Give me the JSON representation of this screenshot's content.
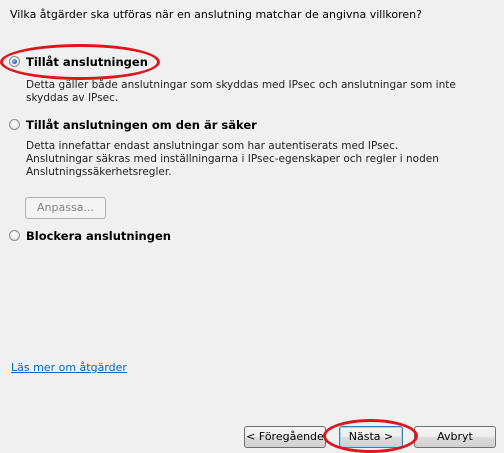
{
  "question": "Vilka åtgärder ska utföras när en anslutning matchar de angivna villkoren?",
  "options": [
    {
      "label": "Tillåt anslutningen",
      "checked": true,
      "description": "Detta gäller både anslutningar som skyddas med IPsec och anslutningar som inte skyddas av IPsec."
    },
    {
      "label": "Tillåt anslutningen om den är säker",
      "checked": false,
      "description": "Detta innefattar endast anslutningar som har autentiserats med IPsec. Anslutningar säkras med inställningarna i IPsec-egenskaper och regler i noden Anslutningssäkerhetsregler."
    },
    {
      "label": "Blockera anslutningen",
      "checked": false
    }
  ],
  "customize_button": "Anpassa...",
  "learn_more_link": "Läs mer om åtgärder",
  "buttons": {
    "back": "< Föregående",
    "next": "Nästa >",
    "cancel": "Avbryt"
  },
  "colors": {
    "highlight_ring": "#e0141c",
    "link": "#0066cc"
  }
}
